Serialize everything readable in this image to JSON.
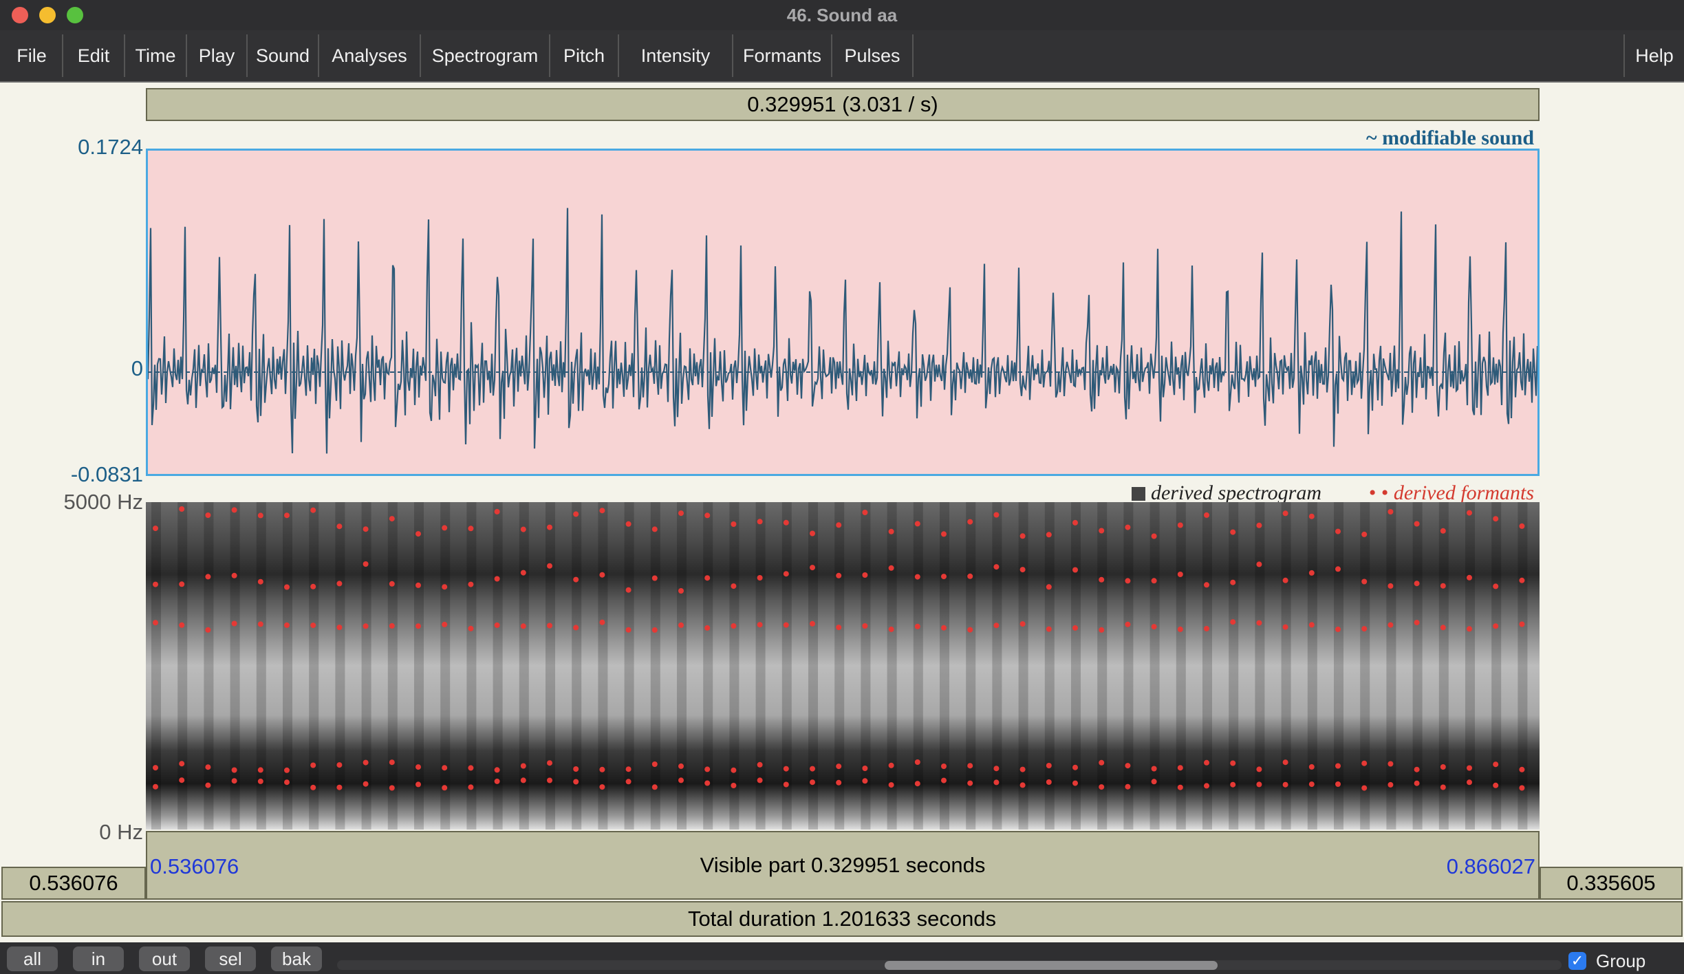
{
  "window": {
    "title": "46. Sound aa"
  },
  "menu": [
    "File",
    "Edit",
    "Time",
    "Play",
    "Sound",
    "Analyses",
    "Spectrogram",
    "Pitch",
    "Intensity",
    "Formants",
    "Pulses"
  ],
  "help_label": "Help",
  "selection": {
    "readout": "0.329951 (3.031 / s)"
  },
  "waveform": {
    "y_max": "0.1724",
    "y_zero": "0",
    "y_min": "-0.0831",
    "legend": "~ modifiable sound"
  },
  "spectrogram": {
    "y_top": "5000 Hz",
    "y_bottom": "0 Hz",
    "legend_spectrogram": "derived spectrogram",
    "legend_formants": "derived formants"
  },
  "time_bar": {
    "left_time": "0.536076",
    "right_time": "0.866027",
    "visible_part": "Visible part 0.329951 seconds",
    "left_outer": "0.536076",
    "right_outer": "0.335605",
    "total": "Total duration 1.201633 seconds"
  },
  "buttons": [
    "all",
    "in",
    "out",
    "sel",
    "bak"
  ],
  "group_label": "Group",
  "colors": {
    "waveform_line": "#2e5a78",
    "waveform_bg": "#f7d4d4",
    "selection_border": "#4aa9e2",
    "formant_dot": "#e53935",
    "time_blue": "#1f38d8"
  }
}
